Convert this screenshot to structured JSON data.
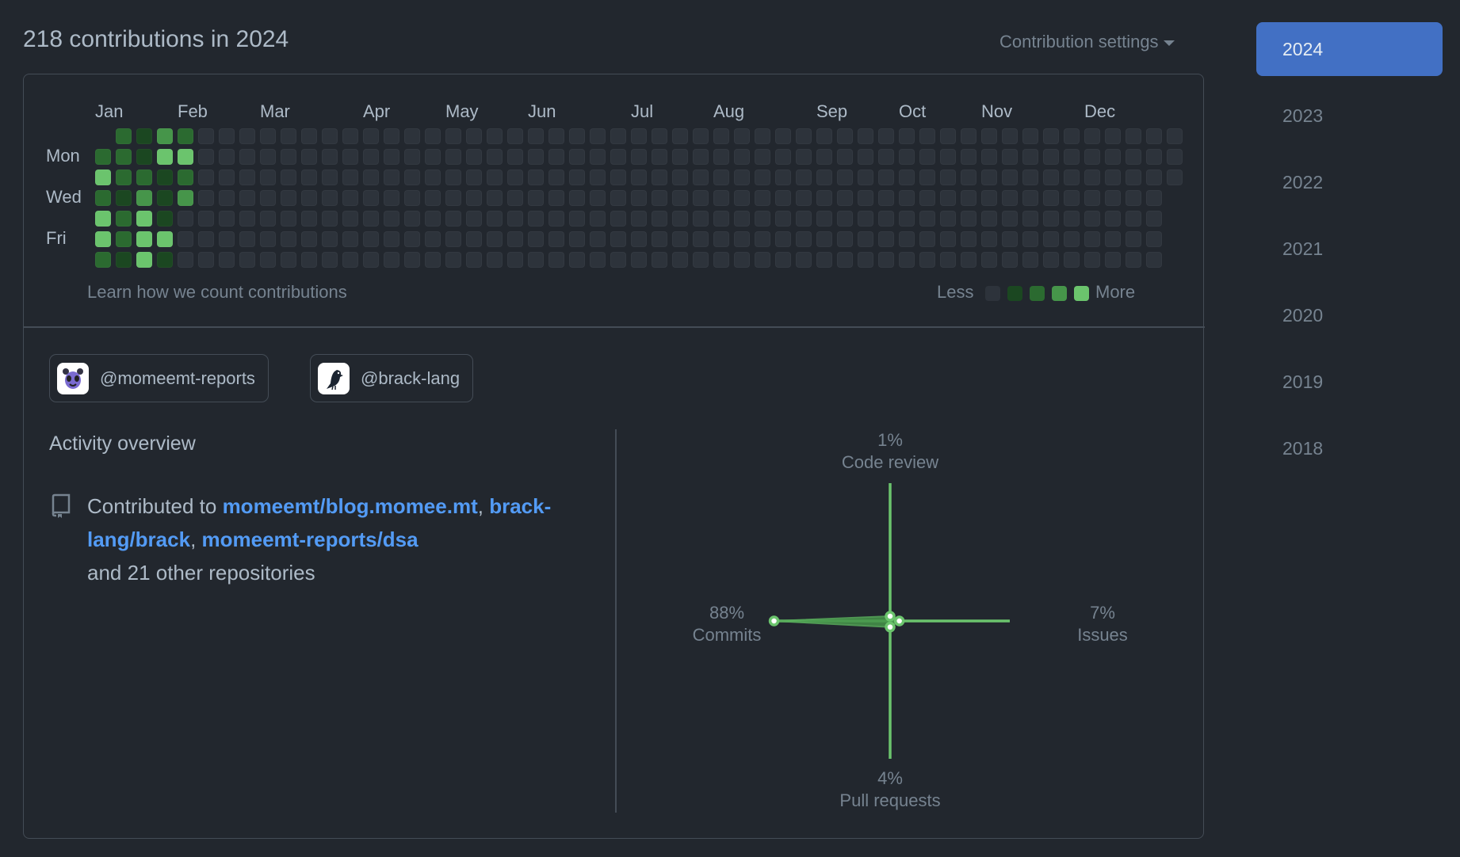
{
  "header": {
    "title": "218 contributions in 2024",
    "settings_label": "Contribution settings"
  },
  "calendar": {
    "months": [
      "Jan",
      "Feb",
      "Mar",
      "Apr",
      "May",
      "Jun",
      "Jul",
      "Aug",
      "Sep",
      "Oct",
      "Nov",
      "Dec"
    ],
    "day_labels": {
      "mon": "Mon",
      "wed": "Wed",
      "fri": "Fri"
    },
    "level_colors": [
      "#2d333b",
      "#1b4721",
      "#2b6a30",
      "#46954a",
      "#6bc46d"
    ],
    "weeks": [
      "-242442",
      "2221221",
      "1123444",
      "3411141",
      "2423000",
      "0000000",
      "0000000",
      "0000000",
      "0000000",
      "0000000",
      "0000000",
      "0000000",
      "0000000",
      "0000000",
      "0000000",
      "0000000",
      "0000000",
      "0000000",
      "0000000",
      "0000000",
      "0000000",
      "0000000",
      "0000000",
      "0000000",
      "0000000",
      "0000000",
      "0000000",
      "0000000",
      "0000000",
      "0000000",
      "0000000",
      "0000000",
      "0000000",
      "0000000",
      "0000000",
      "0000000",
      "0000000",
      "0000000",
      "0000000",
      "0000000",
      "0000000",
      "0000000",
      "0000000",
      "0000000",
      "0000000",
      "0000000",
      "0000000",
      "0000000",
      "0000000",
      "0000000",
      "0000000",
      "0000000",
      "000----"
    ],
    "learn_link": "Learn how we count contributions",
    "legend_less": "Less",
    "legend_more": "More"
  },
  "orgs": [
    {
      "handle": "@momeemt-reports",
      "avatar_icon": "panda-avatar"
    },
    {
      "handle": "@brack-lang",
      "avatar_icon": "crow-avatar"
    }
  ],
  "activity": {
    "title": "Activity overview",
    "prefix": "Contributed to ",
    "repos": [
      "momeemt/blog.momee.mt",
      "brack-lang/brack",
      "momeemt-reports/dsa"
    ],
    "suffix": "and 21 other repositories"
  },
  "chart_data": {
    "type": "radar",
    "axes": [
      {
        "name": "Code review",
        "pct_label": "1%",
        "value": 1,
        "direction": "top"
      },
      {
        "name": "Issues",
        "pct_label": "7%",
        "value": 7,
        "direction": "right"
      },
      {
        "name": "Pull requests",
        "pct_label": "4%",
        "value": 4,
        "direction": "bottom"
      },
      {
        "name": "Commits",
        "pct_label": "88%",
        "value": 88,
        "direction": "left"
      }
    ],
    "color": "#57ab5a"
  },
  "years": [
    "2024",
    "2023",
    "2022",
    "2021",
    "2020",
    "2019",
    "2018"
  ],
  "selected_year": "2024",
  "colors": {
    "background": "#22272e",
    "link": "#539bf5",
    "selected": "#4270c4"
  }
}
